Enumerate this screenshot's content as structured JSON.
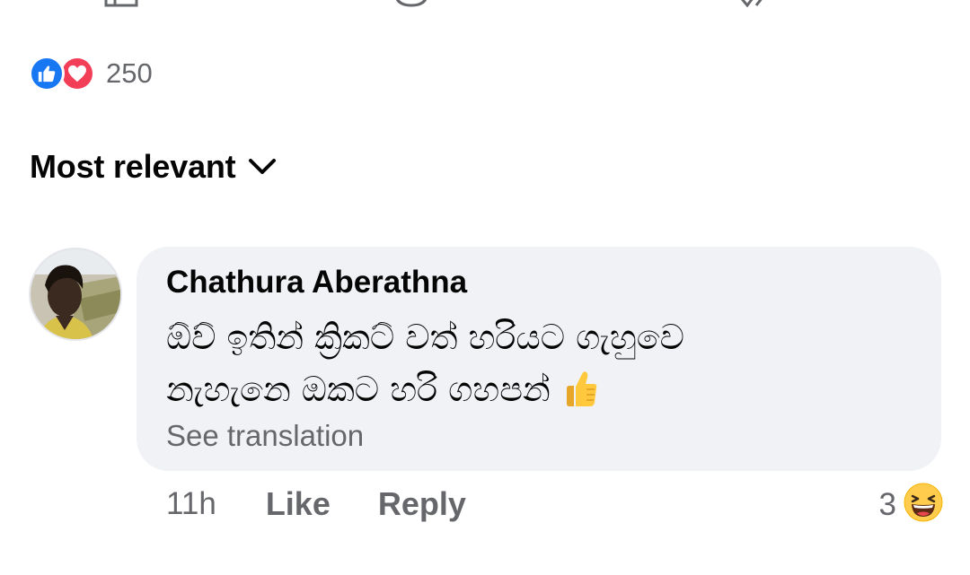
{
  "reactions": {
    "count": "250",
    "types": [
      "like-icon",
      "love-icon"
    ]
  },
  "sort": {
    "label": "Most relevant",
    "icon": "chevron-down-icon"
  },
  "comment": {
    "author": "Chathura Aberathna",
    "text_line1": "ඕව් ඉතින් ක්‍රිකට් වත් හරියට ගැහුවෙ",
    "text_line2": "නැහැනෙ ඔකට හරි ගහපන්",
    "emoji": "thumbs-up-icon",
    "see_translation": "See translation",
    "time": "11h",
    "like_label": "Like",
    "reply_label": "Reply",
    "reaction_count": "3",
    "reaction_icon": "haha-icon"
  },
  "colors": {
    "like_blue": "#1877f2",
    "love_red": "#f33e58",
    "bubble_bg": "#f0f2f5",
    "secondary_text": "#65676b"
  }
}
